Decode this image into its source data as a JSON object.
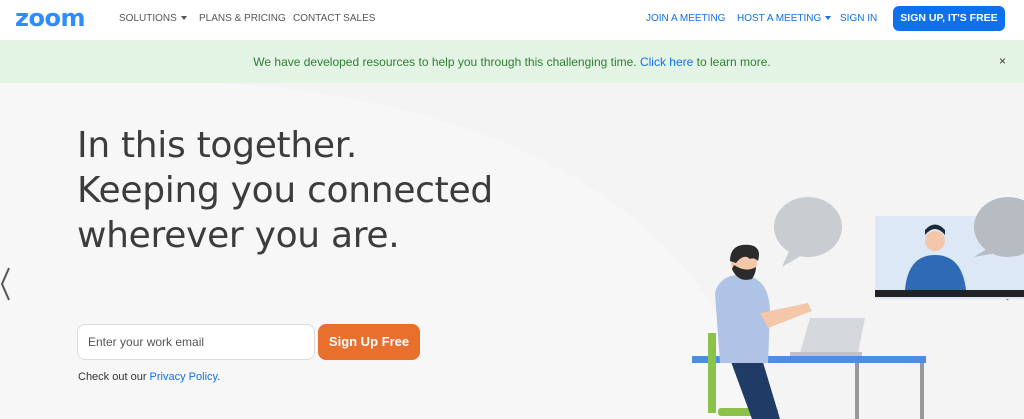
{
  "nav": {
    "logo": "zoom",
    "solutions": "SOLUTIONS",
    "plans": "PLANS & PRICING",
    "contact": "CONTACT SALES",
    "join": "JOIN A MEETING",
    "host": "HOST A MEETING",
    "signin": "SIGN IN",
    "signup": "SIGN UP, IT'S FREE"
  },
  "banner": {
    "text_before": "We have developed resources to help you through this challenging time. ",
    "link": "Click here",
    "text_after": " to learn more.",
    "close": "×"
  },
  "hero": {
    "line1": "In this together.",
    "line2": "Keeping you connected",
    "line3": "wherever you are.",
    "email_placeholder": "Enter your work email",
    "signup_button": "Sign Up Free",
    "privacy_prefix": "Check out our ",
    "privacy_link": "Privacy Policy",
    "privacy_suffix": "."
  },
  "colors": {
    "brand": "#2D8CFF",
    "link": "#0E71EB",
    "cta": "#E86F2C",
    "banner_bg": "#E3F4E4",
    "banner_text": "#2E7D32"
  },
  "icons": {
    "carousel_prev": "chevron-left-icon",
    "carousel_next": "chevron-right-icon",
    "close": "close-icon"
  }
}
